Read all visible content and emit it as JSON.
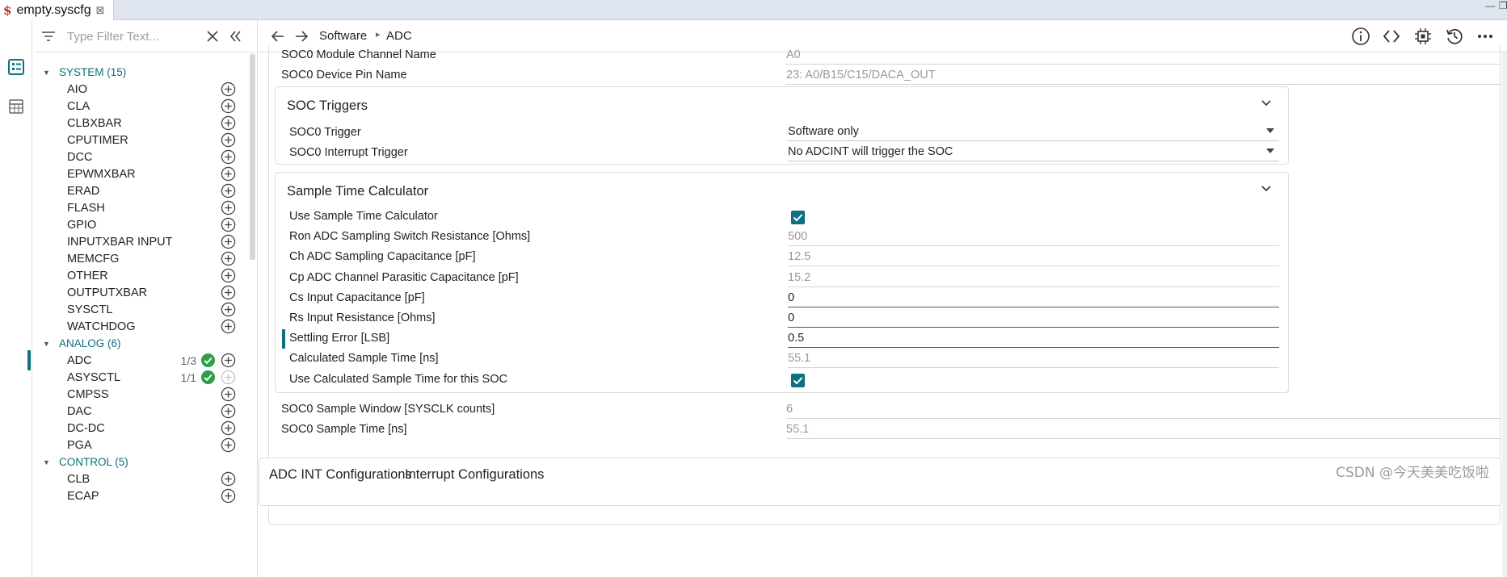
{
  "tab": {
    "icon": "syscfg-file-icon",
    "label": "empty.syscfg",
    "close": "⊠"
  },
  "window_controls": {
    "minimize": "—",
    "restore": "❐"
  },
  "filter": {
    "placeholder": "Type Filter Text..."
  },
  "tree": [
    {
      "type": "group",
      "label": "SYSTEM (15)"
    },
    {
      "type": "item",
      "label": "AIO"
    },
    {
      "type": "item",
      "label": "CLA"
    },
    {
      "type": "item",
      "label": "CLBXBAR"
    },
    {
      "type": "item",
      "label": "CPUTIMER"
    },
    {
      "type": "item",
      "label": "DCC"
    },
    {
      "type": "item",
      "label": "EPWMXBAR"
    },
    {
      "type": "item",
      "label": "ERAD"
    },
    {
      "type": "item",
      "label": "FLASH"
    },
    {
      "type": "item",
      "label": "GPIO"
    },
    {
      "type": "item",
      "label": "INPUTXBAR INPUT"
    },
    {
      "type": "item",
      "label": "MEMCFG"
    },
    {
      "type": "item",
      "label": "OTHER"
    },
    {
      "type": "item",
      "label": "OUTPUTXBAR"
    },
    {
      "type": "item",
      "label": "SYSCTL"
    },
    {
      "type": "item",
      "label": "WATCHDOG"
    },
    {
      "type": "group",
      "label": "ANALOG (6)"
    },
    {
      "type": "item",
      "label": "ADC",
      "count": "1/3",
      "ok": true,
      "selected": true
    },
    {
      "type": "item",
      "label": "ASYSCTL",
      "count": "1/1",
      "ok": true,
      "add_disabled": true
    },
    {
      "type": "item",
      "label": "CMPSS"
    },
    {
      "type": "item",
      "label": "DAC"
    },
    {
      "type": "item",
      "label": "DC-DC"
    },
    {
      "type": "item",
      "label": "PGA"
    },
    {
      "type": "group",
      "label": "CONTROL (5)"
    },
    {
      "type": "item",
      "label": "CLB"
    },
    {
      "type": "item",
      "label": "ECAP"
    }
  ],
  "breadcrumb": {
    "root": "Software",
    "current": "ADC"
  },
  "header_icons": [
    "info-icon",
    "code-icon",
    "chip-icon",
    "history-icon",
    "more-icon"
  ],
  "fields_top": [
    {
      "label": "SOC0 Module Channel Name",
      "value": "A0"
    },
    {
      "label": "SOC0 Device Pin Name",
      "value": "23: A0/B15/C15/DACA_OUT"
    }
  ],
  "soc_triggers": {
    "title": "SOC Triggers",
    "rows": [
      {
        "label": "SOC0 Trigger",
        "value": "Software only"
      },
      {
        "label": "SOC0 Interrupt Trigger",
        "value": "No ADCINT will trigger the SOC"
      }
    ]
  },
  "sample_calc": {
    "title": "Sample Time Calculator",
    "rows": [
      {
        "label": "Use Sample Time Calculator",
        "kind": "check"
      },
      {
        "label": "Ron ADC Sampling Switch Resistance [Ohms]",
        "value": "500",
        "kind": "ro"
      },
      {
        "label": "Ch ADC Sampling Capacitance [pF]",
        "value": "12.5",
        "kind": "ro"
      },
      {
        "label": "Cp ADC Channel Parasitic Capacitance [pF]",
        "value": "15.2",
        "kind": "ro"
      },
      {
        "label": "Cs Input Capacitance [pF]",
        "value": "0",
        "kind": "edit"
      },
      {
        "label": "Rs Input Resistance [Ohms]",
        "value": "0",
        "kind": "edit"
      },
      {
        "label": "Settling Error [LSB]",
        "value": "0.5",
        "kind": "edit",
        "focused": true
      },
      {
        "label": "Calculated Sample Time [ns]",
        "value": "55.1",
        "kind": "ro"
      },
      {
        "label": "Use Calculated Sample Time for this SOC",
        "kind": "check"
      }
    ]
  },
  "fields_bottom": [
    {
      "label": "SOC0 Sample Window [SYSCLK counts]",
      "value": "6"
    },
    {
      "label": "SOC0 Sample Time [ns]",
      "value": "55.1"
    }
  ],
  "bottom_tabs": [
    "ADC INT Configurations",
    "Interrupt Configurations"
  ],
  "watermark": "CSDN @今天美美吃饭啦",
  "colors": {
    "accent": "#0e7181",
    "ok_green": "#2e9e4a",
    "group_text": "#0b6f7c"
  }
}
